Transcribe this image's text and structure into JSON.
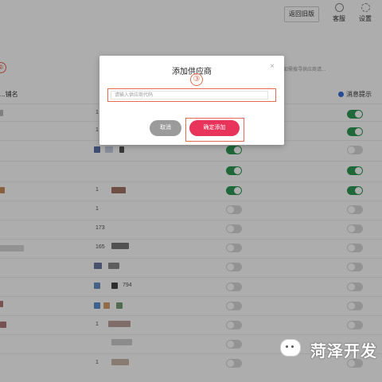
{
  "header": {
    "old_version_label": "返回旧版",
    "service_label": "客服",
    "settings_label": "设置"
  },
  "background": {
    "step2_marker": "②",
    "hint_text": "如需搜寻供应商请...",
    "column_name_header": "...铺名",
    "column_notify_header": "消息提示",
    "rows": [
      {
        "col2": "1"
      },
      {
        "col2": "1"
      },
      {
        "col2": ""
      },
      {
        "col2": ""
      },
      {
        "col2": "1"
      },
      {
        "col2": "1"
      },
      {
        "col2": "173"
      },
      {
        "col2": "165"
      },
      {
        "col2": ""
      },
      {
        "col2": "794"
      },
      {
        "col2": ""
      },
      {
        "col2": "1"
      },
      {
        "col2": ""
      },
      {
        "col2": "1"
      }
    ]
  },
  "modal": {
    "title": "添加供应商",
    "step3_marker": "③",
    "input_placeholder": "请输入供应商代码",
    "input_value": "",
    "cancel_label": "取消",
    "confirm_label": "确定添加"
  },
  "watermark": {
    "text": "菏泽开发"
  },
  "colors": {
    "accent_red": "#e8335a",
    "annotation_orange": "#e46b4f",
    "toggle_on": "#2e9a55"
  }
}
